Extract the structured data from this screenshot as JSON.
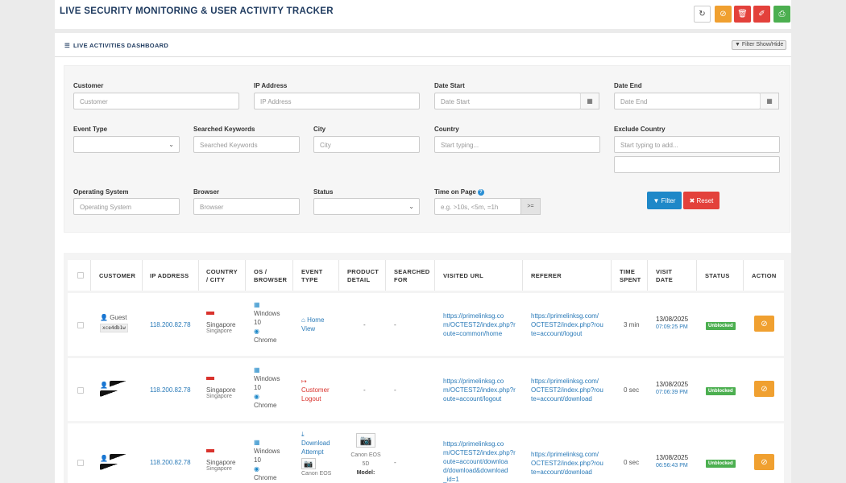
{
  "app": {
    "title": "LIVE SECURITY MONITORING & USER ACTIVITY TRACKER"
  },
  "toolbar": {
    "refresh_icon": "↻",
    "ban_icon": "⊘",
    "trash_icon": "🗑",
    "eraser_icon": "✐",
    "excel_icon": "⎙"
  },
  "panel": {
    "title": "LIVE ACTIVITIES DASHBOARD",
    "list_icon": "☰",
    "filter_toggle": "▼ Filter Show/Hide"
  },
  "filters": {
    "customer": {
      "label": "Customer",
      "placeholder": "Customer"
    },
    "ip": {
      "label": "IP Address",
      "placeholder": "IP Address"
    },
    "date_start": {
      "label": "Date Start",
      "placeholder": "Date Start"
    },
    "date_end": {
      "label": "Date End",
      "placeholder": "Date End"
    },
    "event_type": {
      "label": "Event Type"
    },
    "keywords": {
      "label": "Searched Keywords",
      "placeholder": "Searched Keywords"
    },
    "city": {
      "label": "City",
      "placeholder": "City"
    },
    "country": {
      "label": "Country",
      "placeholder": "Start typing..."
    },
    "exclude_country": {
      "label": "Exclude Country",
      "placeholder": "Start typing to add..."
    },
    "os": {
      "label": "Operating System",
      "placeholder": "Operating System"
    },
    "browser": {
      "label": "Browser",
      "placeholder": "Browser"
    },
    "status": {
      "label": "Status"
    },
    "time_on_page": {
      "label": "Time on Page",
      "placeholder": "e.g. >10s, <5m, =1h",
      "addon": ">="
    },
    "calendar_icon": "▦",
    "chevron_icon": "⌄",
    "help_icon": "?",
    "filter_button": "▼ Filter",
    "reset_button": "✖ Reset"
  },
  "table": {
    "headers": {
      "customer": "CUSTOMER",
      "ip": "IP ADDRESS",
      "country1": "COUNTRY",
      "country2": "/ CITY",
      "os1": "OS /",
      "os2": "BROWSER",
      "event1": "EVENT",
      "event2": "TYPE",
      "product1": "PRODUCT",
      "product2": "DETAIL",
      "searched1": "SEARCHED",
      "searched2": "FOR",
      "url": "VISITED URL",
      "referer": "REFERER",
      "time1": "TIME",
      "time2": "SPENT",
      "date1": "VISIT",
      "date2": "DATE",
      "status": "STATUS",
      "action": "ACTION"
    },
    "rows": [
      {
        "customer": "Guest",
        "customer_code": "xce4db1w",
        "ip": "118.200.82.78",
        "country": "Singapore",
        "city": "Singapore",
        "os1": "Windows",
        "os2": "10",
        "browser": "Chrome",
        "event_icon": "⌂",
        "event1": "Home",
        "event2": "View",
        "product": "-",
        "searched": "-",
        "url": [
          "https://primelinksg.co",
          "m/OCTEST2/index.php?r",
          "oute=common/home"
        ],
        "referer": [
          "https://primelinksg.com/",
          "OCTEST2/index.php?rou",
          "te=account/logout"
        ],
        "time": "3 min",
        "date": "13/08/2025",
        "clock": "07:09:25 PM",
        "status": "Unblocked",
        "action_icon": "⊘"
      },
      {
        "ip": "118.200.82.78",
        "country": "Singapore",
        "city": "Singapore",
        "os1": "Windows",
        "os2": "10",
        "browser": "Chrome",
        "event_icon": "↦",
        "event1": "Customer",
        "event2": "Logout",
        "product": "-",
        "searched": "-",
        "url": [
          "https://primelinksg.co",
          "m/OCTEST2/index.php?r",
          "oute=account/logout"
        ],
        "referer": [
          "https://primelinksg.com/",
          "OCTEST2/index.php?rou",
          "te=account/download"
        ],
        "time": "0 sec",
        "date": "13/08/2025",
        "clock": "07:06:39 PM",
        "status": "Unblocked",
        "action_icon": "⊘"
      },
      {
        "ip": "118.200.82.78",
        "country": "Singapore",
        "city": "Singapore",
        "os1": "Windows",
        "os2": "10",
        "browser": "Chrome",
        "event_icon": "⤓",
        "event1": "Download",
        "event2": "Attempt",
        "event_product": "Canon EOS",
        "product1": "Canon EOS",
        "product2": "5D",
        "product3": "Model:",
        "searched": "-",
        "url": [
          "https://primelinksg.co",
          "m/OCTEST2/index.php?r",
          "oute=account/downloa",
          "d/download&download",
          "_id=1"
        ],
        "referer": [
          "https://primelinksg.com/",
          "OCTEST2/index.php?rou",
          "te=account/download"
        ],
        "time": "0 sec",
        "date": "13/08/2025",
        "clock": "06:56:43 PM",
        "status": "Unblocked",
        "action_icon": "⊘"
      }
    ]
  }
}
